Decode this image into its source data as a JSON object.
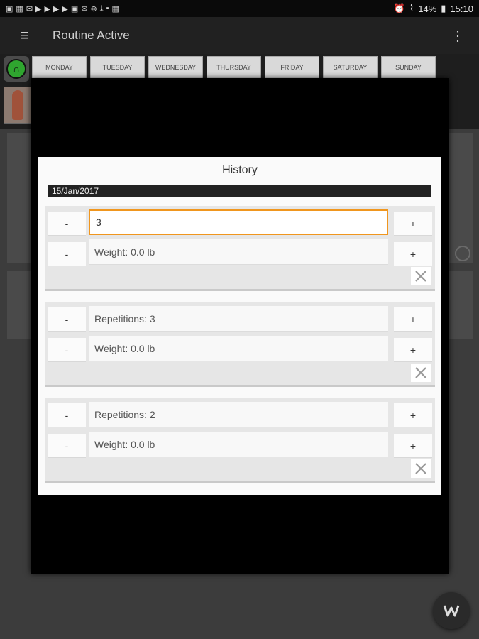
{
  "status": {
    "battery": "14%",
    "time": "15:10"
  },
  "app": {
    "title": "Routine Active"
  },
  "days": [
    "MONDAY",
    "TUESDAY",
    "WEDNESDAY",
    "THURSDAY",
    "FRIDAY",
    "SATURDAY",
    "SUNDAY"
  ],
  "history": {
    "title": "History",
    "date": "15/Jan/2017",
    "sets": [
      {
        "reps_value": "3",
        "weight": "Weight: 0.0 lb"
      },
      {
        "reps": "Repetitions: 3",
        "weight": "Weight: 0.0 lb"
      },
      {
        "reps": "Repetitions: 2",
        "weight": "Weight: 0.0 lb"
      }
    ]
  },
  "buttons": {
    "minus": "-",
    "plus": "+"
  },
  "colors": {
    "accent_orange": "#f0961e",
    "green": "#2fa52f"
  }
}
